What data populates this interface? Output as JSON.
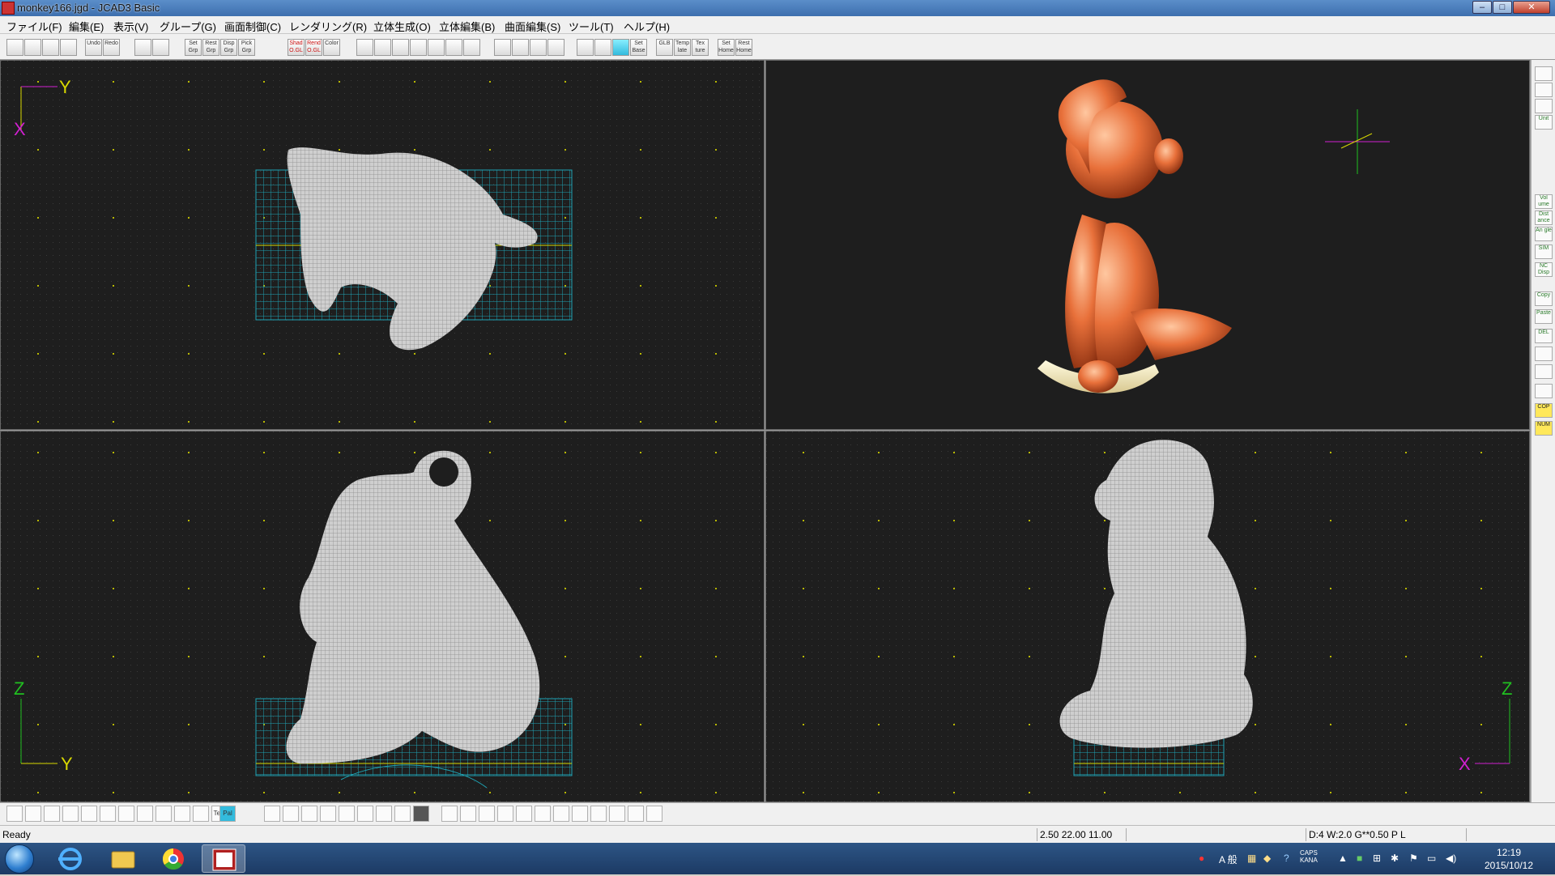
{
  "window": {
    "title": "monkey166.jgd - JCAD3 Basic",
    "minimize": "–",
    "maximize": "□",
    "close": "✕"
  },
  "menu": [
    "ファイル(F)",
    "編集(E)",
    "表示(V)",
    "グループ(G)",
    "画面制御(C)",
    "レンダリング(R)",
    "立体生成(O)",
    "立体編集(B)",
    "曲面編集(S)",
    "ツール(T)",
    "ヘルプ(H)"
  ],
  "toolbar": [
    "",
    "",
    "",
    "",
    "Undo",
    "Redo",
    "",
    "",
    "Set Grp",
    "Rest Grp",
    "Disp Grp",
    "Pick Grp",
    "Shad O.GL",
    "Rend O.GL",
    "Color",
    "",
    "",
    "",
    "",
    "",
    "",
    "",
    "",
    "",
    "",
    "",
    "",
    "",
    "",
    "Set Base",
    "GLB",
    "Temp late",
    "Tex ture",
    "Set Home",
    "Rest Home"
  ],
  "views": {
    "top": {
      "axis_v": "X",
      "axis_h": "Y"
    },
    "front": {
      "axis_v": "Z",
      "axis_h": "Y"
    },
    "side": {
      "axis_v": "Z",
      "axis_h": "X"
    }
  },
  "rightpanel": [
    "",
    "",
    "",
    "Unit",
    "Vol ume",
    "Dist ance",
    "An gle",
    "SIM",
    "NC Disp",
    "Copy",
    "Paste",
    "DEL",
    "",
    "",
    "",
    "COP",
    "NUM"
  ],
  "bottomtools": [
    "",
    "",
    "",
    "",
    "",
    "",
    "",
    "",
    "",
    "",
    "",
    "Text",
    "Pal",
    "",
    "",
    "",
    "",
    "",
    "",
    "",
    "",
    "",
    "",
    "",
    "",
    "",
    "",
    "",
    "",
    "",
    "",
    "",
    "",
    "",
    "",
    "",
    ""
  ],
  "status": {
    "ready": "Ready",
    "coords": "2.50 22.00 11.00",
    "info": "D:4 W:2.0  G**0.50 P   L"
  },
  "taskbar": {
    "time": "12:19",
    "date": "2015/10/12",
    "ime": "A 般",
    "caps": "CAPS KANA"
  },
  "colors": {
    "viewport_bg": "#1e1e1e",
    "grid_cyan": "#1ea3b4",
    "grid_dot": "#b8b800",
    "axis_yellow": "#d8d800",
    "axis_magenta": "#d020d0",
    "axis_green": "#20c020",
    "wire": "#d8d8d8",
    "render": "#e8703a"
  }
}
